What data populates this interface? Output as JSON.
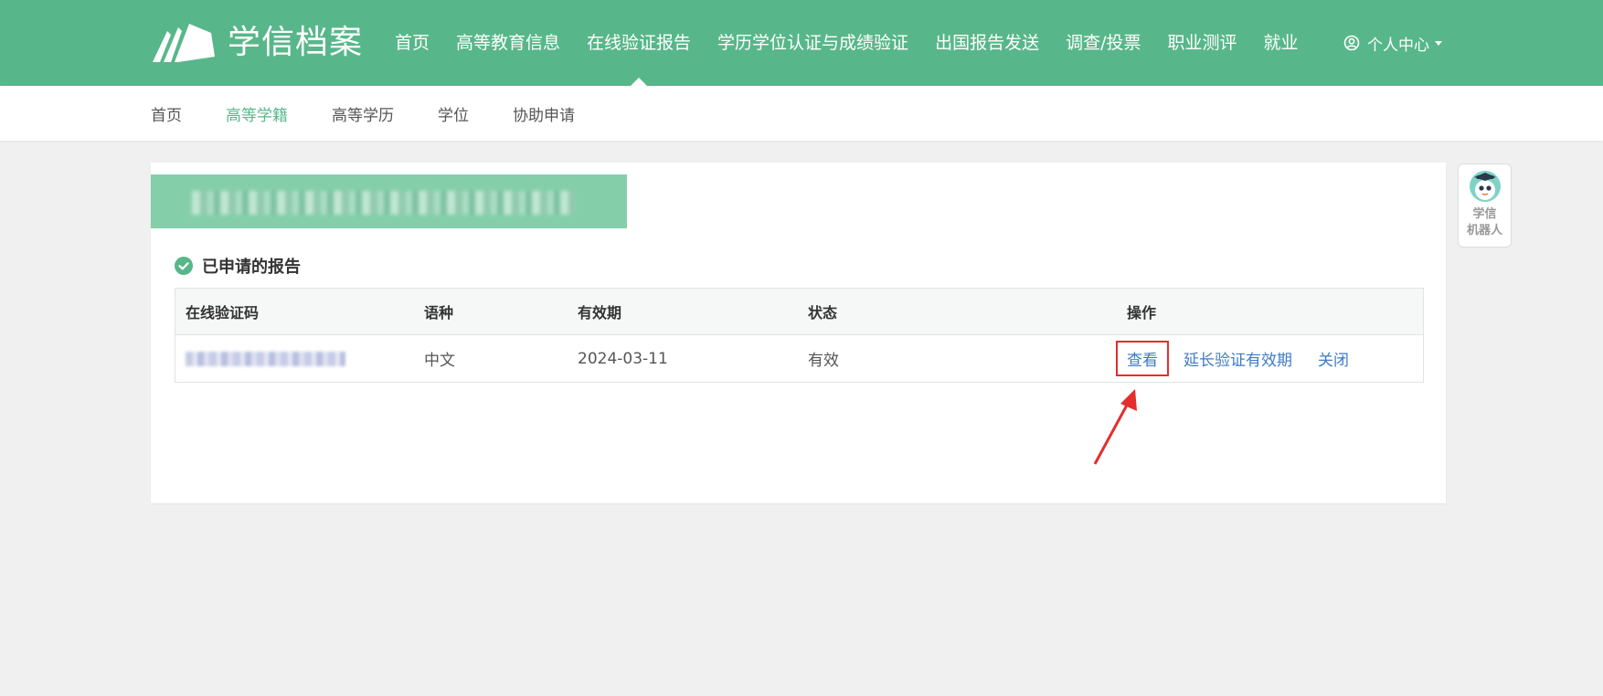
{
  "header": {
    "logo_text": "学信档案",
    "nav": [
      {
        "label": "首页"
      },
      {
        "label": "高等教育信息"
      },
      {
        "label": "在线验证报告",
        "active": true
      },
      {
        "label": "学历学位认证与成绩验证"
      },
      {
        "label": "出国报告发送"
      },
      {
        "label": "调查/投票"
      },
      {
        "label": "职业测评"
      },
      {
        "label": "就业"
      }
    ],
    "user_center": "个人中心"
  },
  "subnav": [
    {
      "label": "首页"
    },
    {
      "label": "高等学籍",
      "active": true
    },
    {
      "label": "高等学历"
    },
    {
      "label": "学位"
    },
    {
      "label": "协助申请"
    }
  ],
  "section_title": "已申请的报告",
  "table": {
    "headers": [
      "在线验证码",
      "语种",
      "有效期",
      "状态",
      "操作"
    ],
    "rows": [
      {
        "language": "中文",
        "validity": "2024-03-11",
        "status": "有效",
        "actions": {
          "view": "查看",
          "extend": "延长验证有效期",
          "close": "关闭"
        }
      }
    ]
  },
  "robot": {
    "label_line1": "学信",
    "label_line2": "机器人"
  },
  "colors": {
    "brand_green": "#58b78a",
    "link_blue": "#3e7bc4",
    "highlight_red": "#e52d2d"
  }
}
